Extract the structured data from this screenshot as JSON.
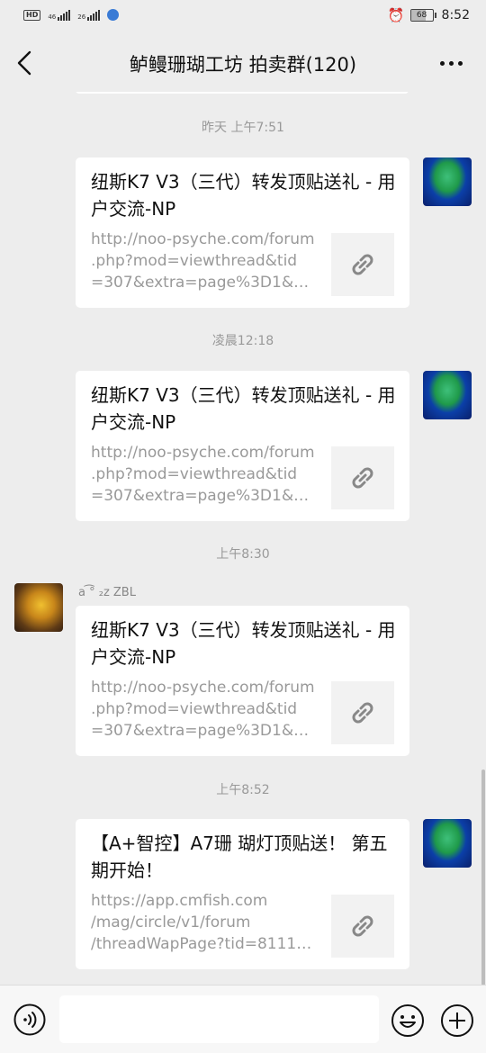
{
  "status_bar": {
    "hd": "HD",
    "sig1_label": "46",
    "sig2_label": "26",
    "battery": "68",
    "time": "8:52"
  },
  "header": {
    "title": "鲈鳗珊瑚工坊 拍卖群(120)"
  },
  "messages": [
    {
      "timestamp": "昨天 上午7:51",
      "title": "纽斯K7 V3（三代）转发顶贴送礼 - 用户交流-NP",
      "url_lines": [
        "http://noo-psyche.com/forum",
        ".php?mod=viewthread&tid",
        "=307&extra=page%3D1&mo…"
      ]
    },
    {
      "timestamp": "凌晨12:18",
      "title": "纽斯K7 V3（三代）转发顶贴送礼 - 用户交流-NP",
      "url_lines": [
        "http://noo-psyche.com/forum",
        ".php?mod=viewthread&tid",
        "=307&extra=page%3D1&mo…"
      ]
    },
    {
      "timestamp": "上午8:30",
      "sender": "a ͡° ₂z ZBL",
      "title": "纽斯K7 V3（三代）转发顶贴送礼 - 用户交流-NP",
      "url_lines": [
        "http://noo-psyche.com/forum",
        ".php?mod=viewthread&tid",
        "=307&extra=page%3D1&mo…"
      ]
    },
    {
      "timestamp": "上午8:52",
      "title": "【A+智控】A7珊 瑚灯顶贴送！ 第五期开始！",
      "url_lines": [
        "https://app.cmfish.com",
        "/mag/circle/v1/forum",
        "/threadWapPage?tid=81119…"
      ]
    }
  ],
  "input": {
    "placeholder": ""
  },
  "colors": {
    "background": "#ededed",
    "bubble": "#ffffff",
    "timestamp": "#999999"
  }
}
